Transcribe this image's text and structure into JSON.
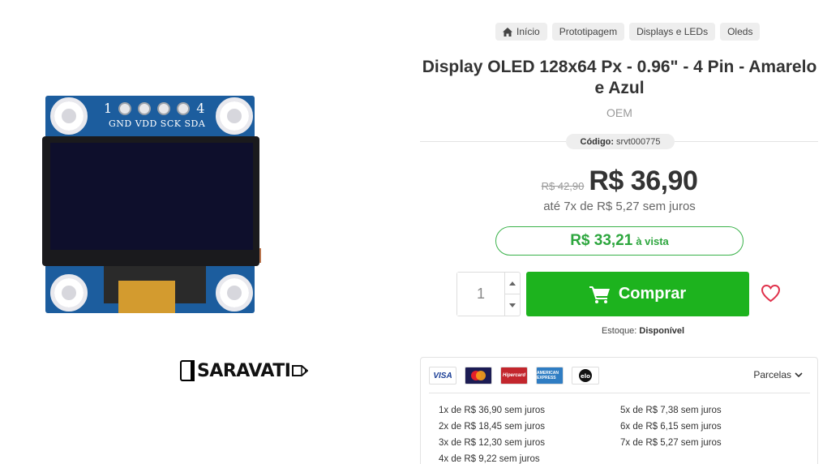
{
  "product_image": {
    "pins": {
      "first": "1",
      "last": "4"
    },
    "pin_labels": "GND VDD SCK SDA"
  },
  "brand_logo": "SARAVATI",
  "breadcrumb": [
    {
      "label": "Início",
      "icon": "home-icon"
    },
    {
      "label": "Prototipagem"
    },
    {
      "label": "Displays e LEDs"
    },
    {
      "label": "Oleds"
    }
  ],
  "product": {
    "title": "Display OLED 128x64 Px - 0.96\" - 4 Pin - Amarelo e Azul",
    "brand": "OEM",
    "code_label": "Código:",
    "code_value": "srvt000775"
  },
  "pricing": {
    "old_price": "R$ 42,90",
    "new_price": "R$ 36,90",
    "installments": "até 7x de R$ 5,27 sem juros",
    "cash_price": "R$ 33,21",
    "cash_label": "à vista"
  },
  "purchase": {
    "quantity": "1",
    "buy_label": "Comprar",
    "stock_label": "Estoque:",
    "stock_value": "Disponível"
  },
  "payment": {
    "cards": [
      {
        "name": "visa",
        "text": "VISA"
      },
      {
        "name": "mastercard",
        "text": ""
      },
      {
        "name": "hipercard",
        "text": "Hipercard"
      },
      {
        "name": "american-express",
        "text": "AMERICAN EXPRESS"
      },
      {
        "name": "elo",
        "text": "elo"
      }
    ],
    "parcelas_label": "Parcelas",
    "installments_col1": [
      "1x de R$ 36,90 sem juros",
      "2x de R$ 18,45 sem juros",
      "3x de R$ 12,30 sem juros",
      "4x de R$ 9,22 sem juros"
    ],
    "installments_col2": [
      "5x de R$ 7,38 sem juros",
      "6x de R$ 6,15 sem juros",
      "7x de R$ 5,27 sem juros"
    ]
  },
  "colors": {
    "buy_button": "#1db31e",
    "cash_accent": "#2da63e",
    "wishlist": "#e0304a"
  }
}
